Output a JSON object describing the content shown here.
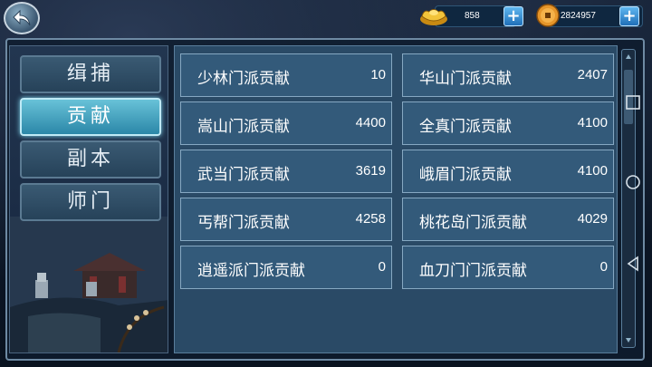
{
  "top_bar": {
    "gold_amount": "858",
    "coin_amount": "2824957"
  },
  "tabs": [
    {
      "label": "缉捕",
      "active": false
    },
    {
      "label": "贡献",
      "active": true
    },
    {
      "label": "副本",
      "active": false
    },
    {
      "label": "师门",
      "active": false
    }
  ],
  "contributions": [
    {
      "label": "少林门派贡献",
      "value": "10"
    },
    {
      "label": "华山门派贡献",
      "value": "2407"
    },
    {
      "label": "嵩山门派贡献",
      "value": "4400"
    },
    {
      "label": "全真门派贡献",
      "value": "4100"
    },
    {
      "label": "武当门派贡献",
      "value": "3619"
    },
    {
      "label": "峨眉门派贡献",
      "value": "4100"
    },
    {
      "label": "丐帮门派贡献",
      "value": "4258"
    },
    {
      "label": "桃花岛门派贡献",
      "value": "4029"
    },
    {
      "label": "逍遥派门派贡献",
      "value": "0"
    },
    {
      "label": "血刀门门派贡献",
      "value": "0"
    }
  ],
  "colors": {
    "active_tab": "#4fb0cc",
    "cell_bg": "#335a7a",
    "plus_button": "#2f8fd8"
  },
  "icons": {
    "back": "back-arrow-icon",
    "gold": "gold-ingot-icon",
    "coin": "copper-coin-icon"
  }
}
